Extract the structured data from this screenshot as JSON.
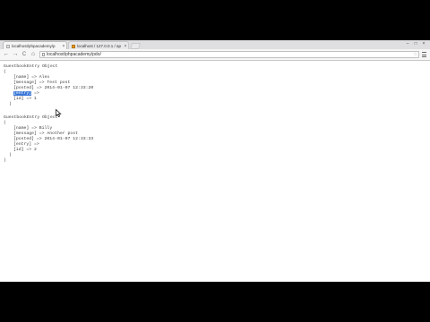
{
  "browser": {
    "tabs": [
      {
        "title": "localhost/phpacademy/p",
        "close": "×",
        "active": true
      },
      {
        "title": "localhost / 127.0.0.1 / ap",
        "close": "×",
        "active": false
      }
    ],
    "window_controls": {
      "minimize": "–",
      "maximize": "□",
      "close": "×"
    },
    "nav": {
      "back": "←",
      "forward": "→",
      "reload": "C",
      "home": "⌂"
    },
    "address": {
      "url": "localhost/phpacademy/pdo/",
      "star": "☆"
    }
  },
  "output": {
    "records": [
      {
        "class_line": "GuestbookEntry Object",
        "open": "(",
        "fields": [
          {
            "key": "[name] =>",
            "value": " Alex"
          },
          {
            "key": "[message] =>",
            "value": " Test post"
          },
          {
            "key": "[posted] =>",
            "value": " 2014-01-07 12:33:20"
          },
          {
            "key": "[entry]",
            "value": " =>",
            "selected_text": "[entry]"
          },
          {
            "key": "[id] =>",
            "value": " 1"
          }
        ],
        "close": ")"
      },
      {
        "class_line": "GuestbookEntry Object",
        "open": "(",
        "fields": [
          {
            "key": "[name] =>",
            "value": " Billy"
          },
          {
            "key": "[message] =>",
            "value": " Another post"
          },
          {
            "key": "[posted] =>",
            "value": " 2014-01-07 12:33:33"
          },
          {
            "key": "[entry] =>",
            "value": ""
          },
          {
            "key": "[id] =>",
            "value": " 2"
          }
        ],
        "close": ")"
      }
    ],
    "outer_close": ")"
  }
}
